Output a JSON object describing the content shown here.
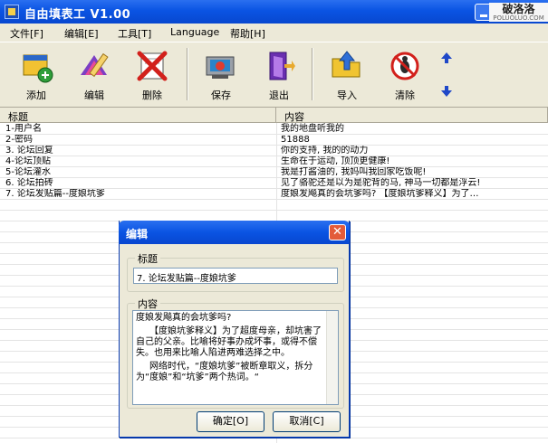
{
  "window": {
    "title": "自由填表工 V1.00"
  },
  "watermark": {
    "main": "破洛洛",
    "sub": "POLUOLUO.COM"
  },
  "menu": [
    "文件[F]",
    "编辑[E]",
    "工具[T]",
    "Language",
    "帮助[H]"
  ],
  "toolbar": {
    "buttons": [
      {
        "label": "添加",
        "icon": "add-icon"
      },
      {
        "label": "编辑",
        "icon": "edit-icon"
      },
      {
        "label": "删除",
        "icon": "delete-icon"
      },
      {
        "label": "保存",
        "icon": "save-icon"
      },
      {
        "label": "退出",
        "icon": "exit-icon"
      },
      {
        "label": "导入",
        "icon": "import-icon"
      },
      {
        "label": "清除",
        "icon": "clear-icon"
      }
    ],
    "up_icon": "arrow-up-icon",
    "down_icon": "arrow-down-icon"
  },
  "list": {
    "columns": [
      "标题",
      "内容"
    ],
    "rows": [
      [
        "1-用户名",
        "我的地盘听我的"
      ],
      [
        "2-密码",
        "51888"
      ],
      [
        "3. 论坛回复",
        "你的支持, 我的的动力"
      ],
      [
        "4-论坛顶贴",
        "生命在于运动, 顶顶更健康!"
      ],
      [
        "5-论坛灌水",
        "我是打酱油的, 我妈叫我回家吃饭呢!"
      ],
      [
        "6. 论坛拍砖",
        "见了骆驼还是以为是驼背的马, 神马一切都是浮云!"
      ],
      [
        "7. 论坛发贴篇--度娘坑爹",
        "度娘发飚真的会坑爹吗?      【度娘坑爹释义】为了…"
      ]
    ]
  },
  "dialog": {
    "title": "编辑",
    "title_group": "标题",
    "title_value": "7. 论坛发贴篇--度娘坑爹",
    "content_group": "内容",
    "content_lines": [
      "度娘发飚真的会坑爹吗?",
      "【度娘坑爹释义】为了超度母亲，却坑害了自己的父亲。比喻将好事办成坏事，或得不偿失。也用来比喻人陷进两难选择之中。",
      "网络时代，“度娘坑爹”被断章取义，拆分为“度娘”和“坑爹”两个热词。“"
    ],
    "ok_label": "确定[O]",
    "cancel_label": "取消[C]"
  }
}
